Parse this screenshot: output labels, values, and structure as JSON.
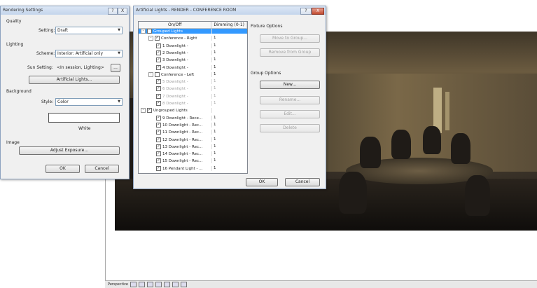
{
  "rendering_settings": {
    "title": "Rendering Settings",
    "quality_section": "Quality",
    "setting_label": "Setting:",
    "setting_value": "Draft",
    "lighting_section": "Lighting",
    "scheme_label": "Scheme:",
    "scheme_value": "Interior: Artificial only",
    "sun_label": "Sun Setting:",
    "sun_value": "<In session, Lighting>",
    "sun_button": "...",
    "artificial_button": "Artificial Lights...",
    "background_section": "Background",
    "style_label": "Style:",
    "style_value": "Color",
    "color_name": "White",
    "image_section": "Image",
    "adjust_button": "Adjust Exposure...",
    "ok": "OK",
    "cancel": "Cancel",
    "help_btn": "?",
    "close_btn": "X"
  },
  "artificial_lights": {
    "title": "Artificial Lights - RENDER - CONFERENCE ROOM",
    "col_onoff": "On/Off",
    "col_dimming": "Dimming (0-1)",
    "rows": [
      {
        "indent": 0,
        "exp": "-",
        "check": "",
        "name": "Grouped Lights",
        "dim": "",
        "style": "hl"
      },
      {
        "indent": 1,
        "exp": "-",
        "check": "✓",
        "name": "Conference - Right",
        "dim": "1",
        "style": ""
      },
      {
        "indent": 2,
        "exp": "",
        "check": "✓",
        "name": "1 Downlight -",
        "dim": "1",
        "style": ""
      },
      {
        "indent": 2,
        "exp": "",
        "check": "✓",
        "name": "2 Downlight -",
        "dim": "1",
        "style": ""
      },
      {
        "indent": 2,
        "exp": "",
        "check": "✓",
        "name": "3 Downlight -",
        "dim": "1",
        "style": ""
      },
      {
        "indent": 2,
        "exp": "",
        "check": "✓",
        "name": "4 Downlight -",
        "dim": "1",
        "style": ""
      },
      {
        "indent": 1,
        "exp": "-",
        "check": "",
        "name": "Conference - Left",
        "dim": "1",
        "style": ""
      },
      {
        "indent": 2,
        "exp": "",
        "check": "✓",
        "name": "5 Downlight -",
        "dim": "1",
        "style": "gray"
      },
      {
        "indent": 2,
        "exp": "",
        "check": "✓",
        "name": "6 Downlight -",
        "dim": "1",
        "style": "gray"
      },
      {
        "indent": 2,
        "exp": "",
        "check": "✓",
        "name": "7 Downlight -",
        "dim": "1",
        "style": "gray"
      },
      {
        "indent": 2,
        "exp": "",
        "check": "✓",
        "name": "8 Downlight -",
        "dim": "1",
        "style": "gray"
      },
      {
        "indent": 0,
        "exp": "-",
        "check": "✓",
        "name": "Ungrouped Lights",
        "dim": "",
        "style": ""
      },
      {
        "indent": 2,
        "exp": "",
        "check": "✓",
        "name": "9 Downlight - Rece...",
        "dim": "1",
        "style": ""
      },
      {
        "indent": 2,
        "exp": "",
        "check": "✓",
        "name": "10 Downlight - Rec...",
        "dim": "1",
        "style": ""
      },
      {
        "indent": 2,
        "exp": "",
        "check": "✓",
        "name": "11 Downlight - Rec...",
        "dim": "1",
        "style": ""
      },
      {
        "indent": 2,
        "exp": "",
        "check": "✓",
        "name": "12 Downlight - Rec...",
        "dim": "1",
        "style": ""
      },
      {
        "indent": 2,
        "exp": "",
        "check": "✓",
        "name": "13 Downlight - Rec...",
        "dim": "1",
        "style": ""
      },
      {
        "indent": 2,
        "exp": "",
        "check": "✓",
        "name": "14 Downlight - Rec...",
        "dim": "1",
        "style": ""
      },
      {
        "indent": 2,
        "exp": "",
        "check": "✓",
        "name": "15 Downlight - Rec...",
        "dim": "1",
        "style": ""
      },
      {
        "indent": 2,
        "exp": "",
        "check": "✓",
        "name": "16 Pendant Light - ...",
        "dim": "1",
        "style": ""
      }
    ],
    "fixture_options": "Fixture Options",
    "move_to_group": "Move to Group...",
    "remove_from_group": "Remove from Group",
    "group_options": "Group Options",
    "new": "New...",
    "rename": "Rename...",
    "edit": "Edit...",
    "delete": "Delete",
    "ok": "OK",
    "cancel": "Cancel",
    "help_btn": "?",
    "close_btn": "X"
  },
  "view_bar": {
    "mode": "Perspective"
  },
  "colors": {
    "selection": "#3399ff",
    "title_bar": "#c4d5ec"
  }
}
